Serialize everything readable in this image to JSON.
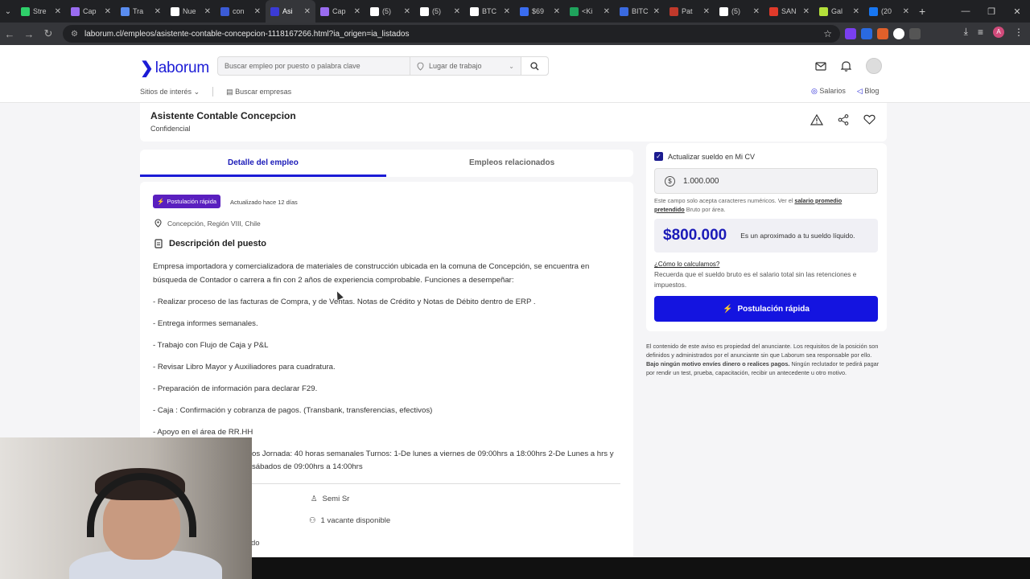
{
  "browser": {
    "tabs": [
      {
        "label": "Stre",
        "color": "#2fd06a"
      },
      {
        "label": "Cap",
        "color": "#9a6cf0"
      },
      {
        "label": "Tra",
        "color": "#5a8df0"
      },
      {
        "label": "Nue",
        "color": "#ffffff"
      },
      {
        "label": "con",
        "color": "#3b5bd6"
      },
      {
        "label": "Asi",
        "color": "#3b3bd6"
      },
      {
        "label": "Cap",
        "color": "#9a6cf0"
      },
      {
        "label": "(5)",
        "color": "#ffffff"
      },
      {
        "label": "(5)",
        "color": "#ffffff"
      },
      {
        "label": "BTC",
        "color": "#ffffff"
      },
      {
        "label": "$69",
        "color": "#3a6df0"
      },
      {
        "label": "<Ki",
        "color": "#1fa35c"
      },
      {
        "label": "BITC",
        "color": "#3a6ae0"
      },
      {
        "label": "Pat",
        "color": "#c0392b"
      },
      {
        "label": "(5)",
        "color": "#ffffff"
      },
      {
        "label": "SAN",
        "color": "#e03a2a"
      },
      {
        "label": "Gal",
        "color": "#b4e03a"
      },
      {
        "label": "(20",
        "color": "#1877f2"
      }
    ],
    "active_tab_index": 5,
    "url": "laborum.cl/empleos/asistente-contable-concepcion-1118167266.html?ia_origen=ia_listados",
    "profile_initial": "A"
  },
  "header": {
    "logo_text": "laborum",
    "search_placeholder": "Buscar empleo por puesto o palabra clave",
    "location_placeholder": "Lugar de trabajo",
    "subnav_interest": "Sitios de interés",
    "subnav_companies": "Buscar empresas",
    "link_salaries": "Salarios",
    "link_blog": "Blog"
  },
  "job": {
    "title": "Asistente Contable Concepcion",
    "company": "Confidencial",
    "tab_detail": "Detalle del empleo",
    "tab_related": "Empleos relacionados",
    "badge": "Postulación rápida",
    "updated": "Actualizado hace 12 días",
    "location": "Concepción, Región VIII, Chile",
    "section_title": "Descripción del puesto",
    "description": [
      "Empresa importadora y comercializadora de materiales de construcción ubicada en la comuna de Concepción, se encuentra en búsqueda de Contador o carrera a fin con 2 años de experiencia comprobable. Funciones a desempeñar:",
      "- Realizar proceso de las facturas de Compra, y de Ventas. Notas de Crédito y Notas de Débito dentro de ERP .",
      "- Entrega informes semanales.",
      "- Trabajo con Flujo de Caja y P&L",
      "- Revisar Libro Mayor y Auxiliadores para cuadratura.",
      "- Preparación de información para declarar F29.",
      "- Caja : Confirmación y cobranza de pagos. (Transbank, transferencias, efectivos)",
      "- Apoyo en el área de RR.HH",
      "os Jornada: 40 horas semanales Turnos: 1-De lunes a viernes de 09:00hrs a 18:00hrs 2-De Lunes a hrs y sábados de 09:00hrs a 14:00hrs"
    ],
    "seniority": "Semi Sr",
    "vacancies": "1 vacante disponible",
    "partial_text": "do"
  },
  "salary_panel": {
    "checkbox_label": "Actualizar sueldo en Mi CV",
    "checkbox_checked": true,
    "salary_value": "1.000.000",
    "hint_prefix": "Este campo solo acepta caracteres numéricos. Ver el ",
    "hint_link": "salario promedio pretendido",
    "hint_suffix": " Bruto por área.",
    "liquid_amount": "$800.000",
    "liquid_label": "Es un aproximado a tu sueldo líquido.",
    "how_link": "¿Cómo lo calculamos?",
    "how_text": "Recuerda que el sueldo bruto es el salario total sin las retenciones e impuestos.",
    "apply_button": "Postulación rápida"
  },
  "disclaimer": {
    "part1": "El contenido de este aviso es propiedad del anunciante. Los requisitos de la posición son definidos y administrados por el anunciante sin que Laborum sea responsable por ello. ",
    "bold": "Bajo ningún motivo envíes dinero o realices pagos.",
    "part2": " Ningún reclutador te pedirá pagar por rendir un test, prueba, capacitación, recibir un antecedente u otro motivo."
  },
  "colors": {
    "brand": "#1b1bd6",
    "badge": "#5a1fbf",
    "apply": "#1414e0"
  }
}
